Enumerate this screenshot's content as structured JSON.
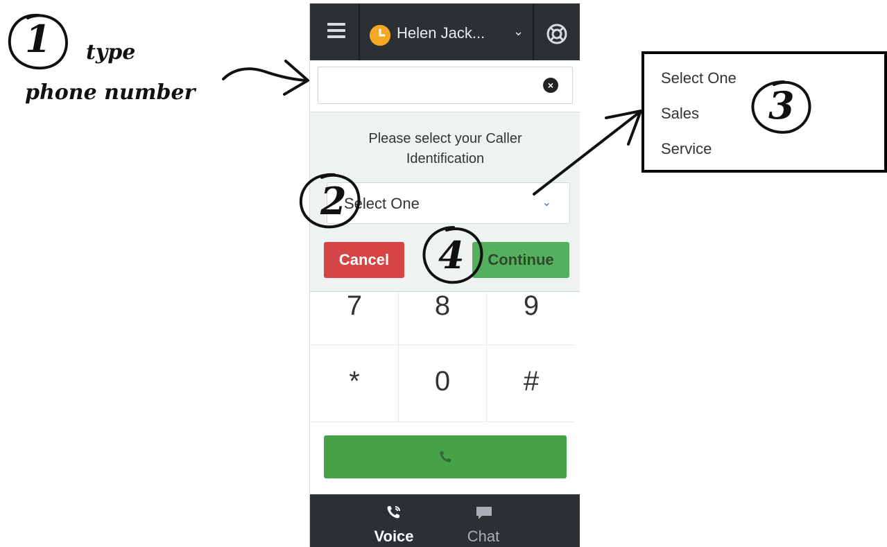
{
  "annotations": {
    "step1_number": "1",
    "step1_line1": "type",
    "step1_line2": "phone number",
    "step2_number": "2",
    "step3_number": "3",
    "step4_number": "4"
  },
  "header": {
    "agent_name": "Helen Jack...",
    "status_color": "#f5a623"
  },
  "number_input": {
    "value": "",
    "placeholder": ""
  },
  "caller_id": {
    "prompt": "Please select your Caller Identification",
    "selected": "Select One",
    "cancel_label": "Cancel",
    "continue_label": "Continue"
  },
  "dropdown_options": [
    "Select One",
    "Sales",
    "Service"
  ],
  "keypad": {
    "keys": [
      "7",
      "8",
      "9",
      "*",
      "0",
      "#"
    ]
  },
  "call_button": {
    "icon": "phone-icon",
    "color": "#46a149"
  },
  "bottom_nav": {
    "tabs": [
      {
        "label": "Voice",
        "icon": "voice-icon",
        "active": true
      },
      {
        "label": "Chat",
        "icon": "chat-icon",
        "active": false
      }
    ]
  },
  "colors": {
    "topbar": "#2b3035",
    "cancel": "#d64545",
    "continue": "#54b05c"
  }
}
